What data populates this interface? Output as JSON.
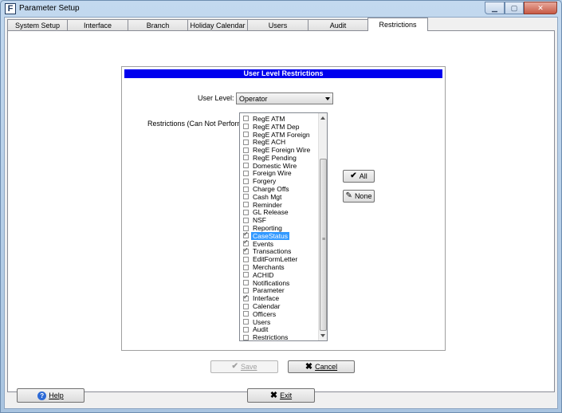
{
  "window": {
    "title": "Parameter Setup"
  },
  "tabs": [
    {
      "label": "System Setup"
    },
    {
      "label": "Interface"
    },
    {
      "label": "Branch"
    },
    {
      "label": "Holiday Calendar"
    },
    {
      "label": "Users"
    },
    {
      "label": "Audit"
    },
    {
      "label": "Restrictions"
    }
  ],
  "active_tab": "Restrictions",
  "group": {
    "title": "User Level Restrictions",
    "user_level_label": "User Level:",
    "user_level_value": "Operator",
    "restrictions_label": "Restrictions (Can Not Perform)"
  },
  "restrictions": [
    {
      "label": "RegE ATM",
      "checked": false,
      "selected": false
    },
    {
      "label": "RegE ATM Dep",
      "checked": false,
      "selected": false
    },
    {
      "label": "RegE ATM Foreign",
      "checked": false,
      "selected": false
    },
    {
      "label": "RegE ACH",
      "checked": false,
      "selected": false
    },
    {
      "label": "RegE Foreign Wire",
      "checked": false,
      "selected": false
    },
    {
      "label": "RegE Pending",
      "checked": false,
      "selected": false
    },
    {
      "label": "Domestic Wire",
      "checked": false,
      "selected": false
    },
    {
      "label": "Foreign Wire",
      "checked": false,
      "selected": false
    },
    {
      "label": "Forgery",
      "checked": false,
      "selected": false
    },
    {
      "label": "Charge Offs",
      "checked": false,
      "selected": false
    },
    {
      "label": "Cash Mgt",
      "checked": false,
      "selected": false
    },
    {
      "label": "Reminder",
      "checked": false,
      "selected": false
    },
    {
      "label": "GL Release",
      "checked": false,
      "selected": false
    },
    {
      "label": "NSF",
      "checked": false,
      "selected": false
    },
    {
      "label": "Reporting",
      "checked": false,
      "selected": false
    },
    {
      "label": "CaseStatus",
      "checked": true,
      "selected": true
    },
    {
      "label": "Events",
      "checked": true,
      "selected": false
    },
    {
      "label": "Transactions",
      "checked": true,
      "selected": false
    },
    {
      "label": "EditFormLetter",
      "checked": false,
      "selected": false
    },
    {
      "label": "Merchants",
      "checked": false,
      "selected": false
    },
    {
      "label": "ACHID",
      "checked": false,
      "selected": false
    },
    {
      "label": "Notifications",
      "checked": false,
      "selected": false
    },
    {
      "label": "Parameter",
      "checked": false,
      "selected": false
    },
    {
      "label": "Interface",
      "checked": true,
      "selected": false
    },
    {
      "label": "Calendar",
      "checked": false,
      "selected": false
    },
    {
      "label": "Officers",
      "checked": false,
      "selected": false
    },
    {
      "label": "Users",
      "checked": false,
      "selected": false
    },
    {
      "label": "Audit",
      "checked": false,
      "selected": false
    },
    {
      "label": "Restrictions",
      "checked": false,
      "selected": false
    }
  ],
  "buttons": {
    "all": "All",
    "none": "None",
    "save": "Save",
    "cancel": "Cancel",
    "help": "Help",
    "exit": "Exit"
  },
  "icons": {
    "app": "app-logo-icon",
    "all": "checkmark-icon",
    "none": "eraser-icon",
    "save": "checkmark-icon",
    "cancel": "x-icon",
    "help": "question-icon",
    "exit": "x-icon"
  },
  "colors": {
    "group_header_bg": "#0000ee",
    "selection": "#3399ff"
  }
}
